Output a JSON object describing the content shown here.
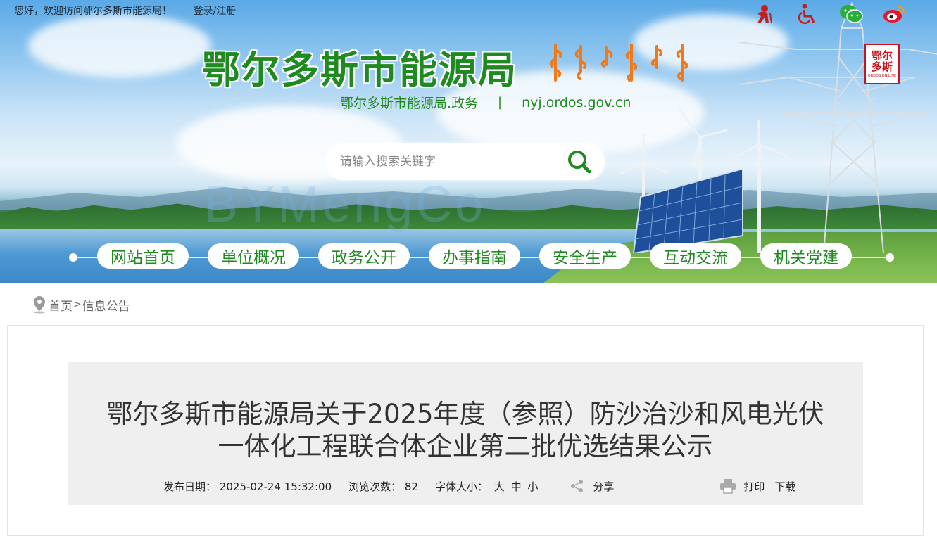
{
  "topbar": {
    "greeting": "您好，欢迎访问鄂尔多斯市能源局！",
    "login": "登录/注册"
  },
  "top_icons": [
    "elderly-mode-icon",
    "accessibility-icon",
    "wechat-icon",
    "weibo-icon"
  ],
  "header": {
    "site_title": "鄂尔多斯市能源局",
    "subtitle_name": "鄂尔多斯市能源局.政务",
    "subtitle_sep": "|",
    "subtitle_domain": "nyj.ordos.gov.cn",
    "logo_line1": "鄂尔",
    "logo_line2": "多斯",
    "logo_sub": "ORDOS ON LINE"
  },
  "search": {
    "placeholder": "请输入搜索关键字"
  },
  "nav": {
    "items": [
      {
        "label": "网站首页"
      },
      {
        "label": "单位概况"
      },
      {
        "label": "政务公开"
      },
      {
        "label": "办事指南"
      },
      {
        "label": "安全生产"
      },
      {
        "label": "互动交流"
      },
      {
        "label": "机关党建"
      }
    ]
  },
  "breadcrumb": {
    "home": "首页",
    "sep": ">",
    "current": "信息公告"
  },
  "article": {
    "title_line1": "鄂尔多斯市能源局关于2025年度（参照）防沙治沙和风电光伏",
    "title_line2": "一体化工程联合体企业第二批优选结果公示",
    "date_label": "发布日期：",
    "date_value": "2025-02-24 15:32:00",
    "views_label": "浏览次数：",
    "views_value": "82",
    "font_size_label": "字体大小：",
    "size_large": "大",
    "size_medium": "中",
    "size_small": "小",
    "share": "分享",
    "print": "打印",
    "download": "下载"
  },
  "colors": {
    "brand_green": "#1f8a1f",
    "header_sky": "#5aa9e6",
    "title_box": "#efefef",
    "logo_red": "#c8141e"
  }
}
